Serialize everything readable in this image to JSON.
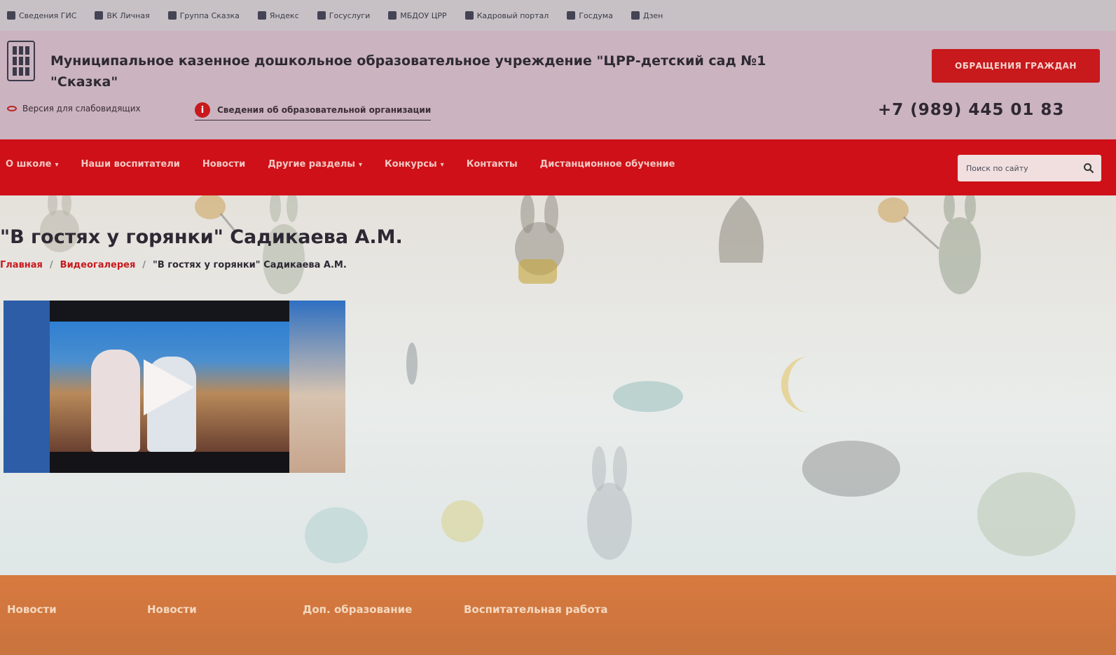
{
  "bookmarks": [
    "Сведения ГИС",
    "ВК Личная",
    "Группа Сказка",
    "Яндекс",
    "Госуслуги",
    "МБДОУ ЦРР",
    "Кадровый портал",
    "Госдума",
    "Дзен"
  ],
  "header": {
    "org_name_line1": "Муниципальное казенное дошкольное образовательное учреждение \"ЦРР-детский сад №1",
    "org_name_line2": "\"Сказка\"",
    "appeal_button": "ОБРАЩЕНИЯ ГРАЖДАН",
    "vision_link": "Версия для слабовидящих",
    "info_icon_glyph": "i",
    "info_link": "Сведения об образовательной организации",
    "phone": "+7 (989) 445 01 83"
  },
  "nav": {
    "items": [
      {
        "label": "О школе",
        "has_submenu": true
      },
      {
        "label": "Наши воспитатели",
        "has_submenu": false
      },
      {
        "label": "Новости",
        "has_submenu": false
      },
      {
        "label": "Другие разделы",
        "has_submenu": true
      },
      {
        "label": "Конкурсы",
        "has_submenu": true
      },
      {
        "label": "Контакты",
        "has_submenu": false
      },
      {
        "label": "Дистанционное обучение",
        "has_submenu": false
      }
    ],
    "search_placeholder": "Поиск по сайту",
    "submenu_caret": "▾"
  },
  "page": {
    "title": "\"В гостях у горянки\" Садикаева А.М.",
    "breadcrumb": [
      {
        "label": "Главная",
        "link": true
      },
      {
        "label": "Видеогалерея",
        "link": true
      },
      {
        "label": "\"В гостях у горянки\" Садикаева А.М.",
        "link": false
      }
    ],
    "breadcrumb_separator": "/"
  },
  "footer": {
    "links": [
      "Новости",
      "Новости",
      "Доп. образование",
      "Воспитательная работа"
    ]
  },
  "colors": {
    "accent_red": "#cf1018",
    "footer_orange": "#d77a3f",
    "header_bg": "#cbb3c0"
  },
  "icons": [
    "eye-icon",
    "info-icon",
    "search-icon",
    "play-icon",
    "logo-icon"
  ]
}
